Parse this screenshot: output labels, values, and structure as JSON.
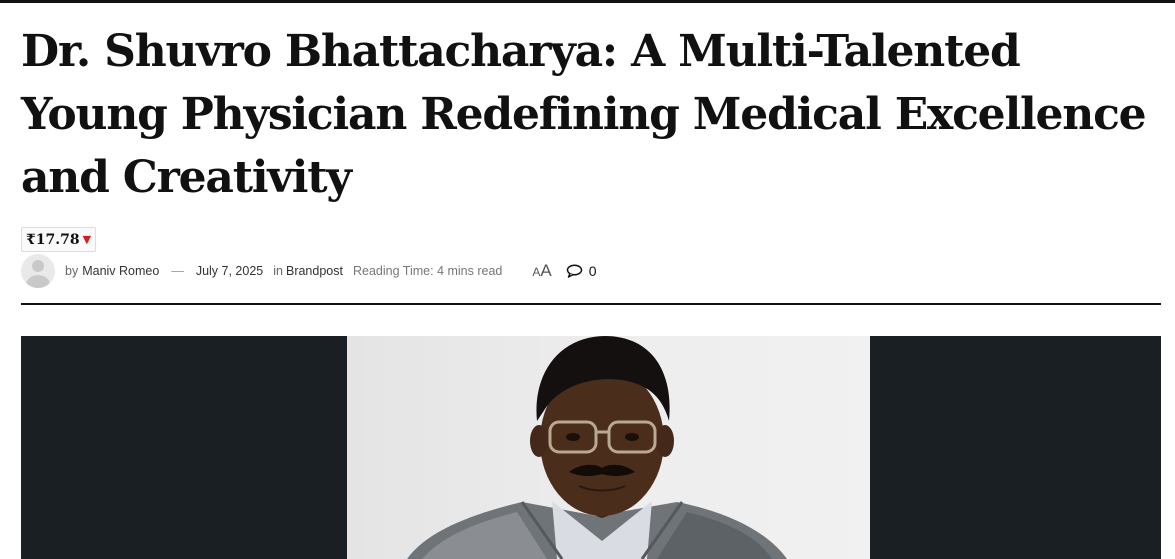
{
  "article": {
    "title": "Dr. Shuvro Bhattacharya: A Multi-Talented Young Physician Redefining Medical Excellence and Creativity"
  },
  "ticker": {
    "price": "₹17.78",
    "direction_icon": "triangle-down-icon",
    "direction_color": "#d12020"
  },
  "meta": {
    "by": "by",
    "author": "Maniv Romeo",
    "separator": "—",
    "date": "July 7, 2025",
    "in": "in",
    "category": "Brandpost",
    "reading_time": "Reading Time: 4 mins read",
    "font_toggle_small": "A",
    "font_toggle_large": "A",
    "comment_count": "0"
  },
  "featured_image": {
    "icon": "portrait-photo",
    "background_color": "#1a1f24"
  }
}
